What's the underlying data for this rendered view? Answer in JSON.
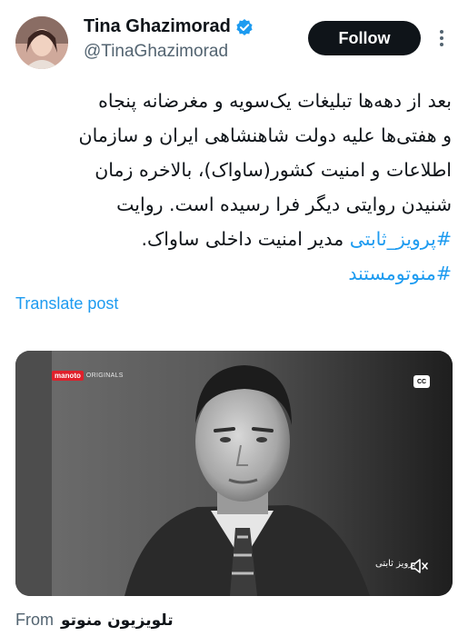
{
  "author": {
    "display_name": "Tina Ghazimorad",
    "handle": "@TinaGhazimorad",
    "verified": true
  },
  "actions": {
    "follow_label": "Follow",
    "more_icon": "more-vertical-icon"
  },
  "tweet": {
    "lines": [
      "بعد از دهه‌ها تبلیغات یک‌سویه و مغرضانه پنجاه",
      "و هفتی‌ها علیه دولت شاهنشاهی ایران و سازمان",
      "اطلاعات و امنیت کشور(ساواک)، بالاخره زمان",
      "شنیدن روایتی دیگر فرا رسیده است. روایت"
    ],
    "hashtag1": "#پرویز_ثابتی",
    "line5_rest": " مدیر امنیت داخلی ساواک.",
    "hashtag2": "#منوتومستند"
  },
  "translate_label": "Translate post",
  "media": {
    "brand_name": "manoto",
    "brand_sub": "ORIGINALS",
    "cc_label": "CC",
    "overlay_caption": "پرویز ثابتی"
  },
  "source": {
    "label": "From",
    "name": "تلویزیون منوتو"
  },
  "colors": {
    "accent": "#1d9bf0",
    "text": "#0f1419",
    "secondary": "#536471",
    "follow_bg": "#0f1419",
    "brand_red": "#e0202b"
  }
}
